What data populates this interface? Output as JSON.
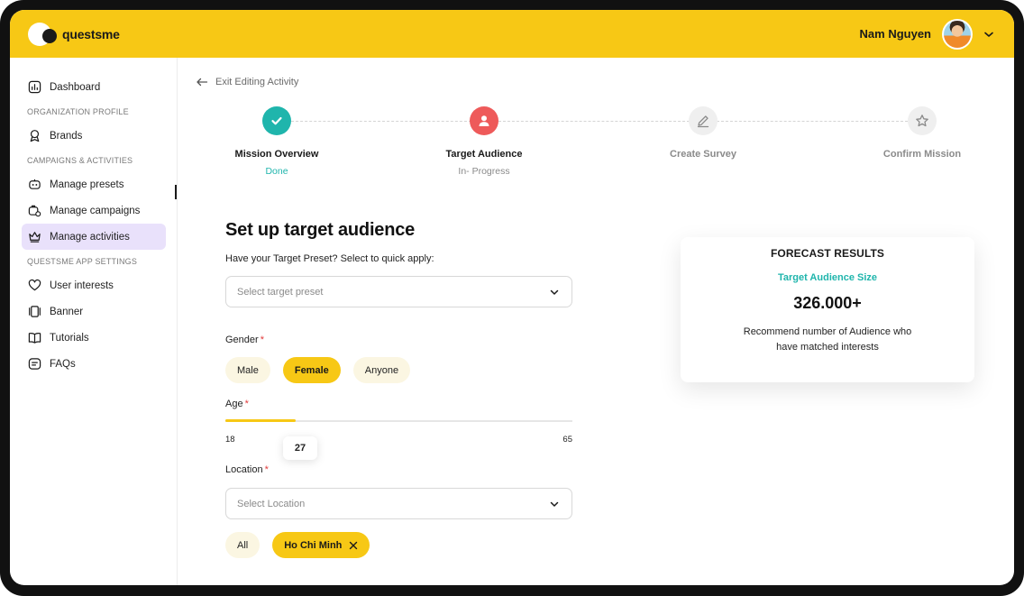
{
  "brand": {
    "name": "questsme"
  },
  "user": {
    "name": "Nam Nguyen"
  },
  "sidebar": {
    "dashboard": "Dashboard",
    "section_org": "ORGANIZATION PROFILE",
    "brands": "Brands",
    "section_campaigns": "CAMPAIGNS & ACTIVITIES",
    "manage_presets": "Manage presets",
    "manage_campaigns": "Manage campaigns",
    "manage_activities": "Manage activities",
    "section_app": "QUESTSME APP SETTINGS",
    "user_interests": "User interests",
    "banner": "Banner",
    "tutorials": "Tutorials",
    "faqs": "FAQs"
  },
  "nav": {
    "exit_label": "Exit Editing Activity"
  },
  "steps": [
    {
      "label": "Mission Overview",
      "status": "Done",
      "state": "done"
    },
    {
      "label": "Target Audience",
      "status": "In- Progress",
      "state": "current"
    },
    {
      "label": "Create Survey",
      "status": "",
      "state": "todo"
    },
    {
      "label": "Confirm Mission",
      "status": "",
      "state": "todo"
    }
  ],
  "form": {
    "title": "Set up target audience",
    "preset_hint": "Have your Target Preset? Select to quick apply:",
    "preset_placeholder": "Select target preset",
    "gender_label": "Gender",
    "gender_options": [
      "Male",
      "Female",
      "Anyone"
    ],
    "gender_selected": "Female",
    "age_label": "Age",
    "age_min": "18",
    "age_max": "65",
    "age_value": "27",
    "location_label": "Location",
    "location_placeholder": "Select Location",
    "location_all": "All",
    "location_selected": "Ho Chi Minh",
    "required_mark": "*"
  },
  "forecast": {
    "title": "FORECAST RESULTS",
    "subtitle": "Target Audience Size",
    "value": "326.000+",
    "description": "Recommend number of Audience who have matched interests"
  },
  "colors": {
    "brand_yellow": "#F7C815",
    "teal": "#1FB5AC",
    "coral": "#EE5A5A",
    "active_nav": "#E9E1FB"
  }
}
